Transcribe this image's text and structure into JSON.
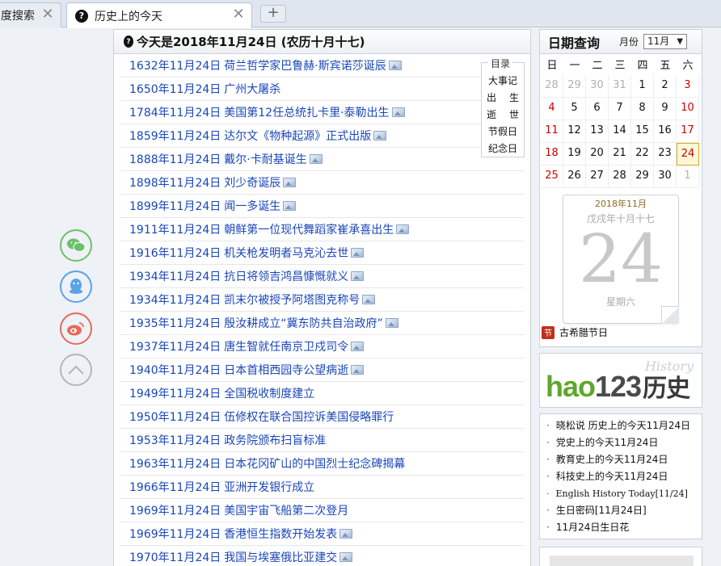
{
  "tabs": [
    {
      "label": "度搜索",
      "active": false
    },
    {
      "label": "历史上的今天",
      "active": true
    }
  ],
  "tab_close_glyph": "✕",
  "new_tab_glyph": "+",
  "main": {
    "title": "今天是2018年11月24日 (农历十月十七)",
    "events": [
      {
        "date": "1632年11月24日",
        "text": "荷兰哲学家巴鲁赫·斯宾诺莎诞辰",
        "has_image": true
      },
      {
        "date": "1650年11月24日",
        "text": "广州大屠杀",
        "has_image": false
      },
      {
        "date": "1784年11月24日",
        "text": "美国第12任总统扎卡里·泰勒出生",
        "has_image": true
      },
      {
        "date": "1859年11月24日",
        "text": "达尔文《物种起源》正式出版",
        "has_image": true
      },
      {
        "date": "1888年11月24日",
        "text": "戴尔·卡耐基诞生",
        "has_image": true
      },
      {
        "date": "1898年11月24日",
        "text": "刘少奇诞辰",
        "has_image": true
      },
      {
        "date": "1899年11月24日",
        "text": "闻一多诞生",
        "has_image": true
      },
      {
        "date": "1911年11月24日",
        "text": "朝鲜第一位现代舞蹈家崔承喜出生",
        "has_image": true
      },
      {
        "date": "1916年11月24日",
        "text": "机关枪发明者马克沁去世",
        "has_image": true
      },
      {
        "date": "1934年11月24日",
        "text": "抗日将领吉鸿昌慷慨就义",
        "has_image": true
      },
      {
        "date": "1934年11月24日",
        "text": "凯末尔被授予阿塔图克称号",
        "has_image": true
      },
      {
        "date": "1935年11月24日",
        "text": "殷汝耕成立“冀东防共自治政府”",
        "has_image": true
      },
      {
        "date": "1937年11月24日",
        "text": "唐生智就任南京卫戍司令",
        "has_image": true
      },
      {
        "date": "1940年11月24日",
        "text": "日本首相西园寺公望病逝",
        "has_image": true
      },
      {
        "date": "1949年11月24日",
        "text": "全国税收制度建立",
        "has_image": false
      },
      {
        "date": "1950年11月24日",
        "text": "伍修权在联合国控诉美国侵略罪行",
        "has_image": false
      },
      {
        "date": "1953年11月24日",
        "text": "政务院颁布扫盲标准",
        "has_image": false
      },
      {
        "date": "1963年11月24日",
        "text": "日本花冈矿山的中国烈士纪念碑揭幕",
        "has_image": false
      },
      {
        "date": "1966年11月24日",
        "text": "亚洲开发银行成立",
        "has_image": false
      },
      {
        "date": "1969年11月24日",
        "text": "美国宇宙飞船第二次登月",
        "has_image": false
      },
      {
        "date": "1969年11月24日",
        "text": "香港恒生指数开始发表",
        "has_image": true
      },
      {
        "date": "1970年11月24日",
        "text": "我国与埃塞俄比亚建交",
        "has_image": true
      }
    ]
  },
  "toc": {
    "title": "目录",
    "items": [
      {
        "label": "大事记"
      },
      {
        "left": "出",
        "right": "生"
      },
      {
        "left": "逝",
        "right": "世"
      },
      {
        "label": "节假日"
      },
      {
        "label": "纪念日"
      }
    ]
  },
  "calendar": {
    "title": "日期查询",
    "month_label": "月份",
    "selected_month": "11月",
    "weekdays": [
      "日",
      "一",
      "二",
      "三",
      "四",
      "五",
      "六"
    ],
    "days": [
      {
        "d": "28",
        "s": "gray"
      },
      {
        "d": "29",
        "s": "gray"
      },
      {
        "d": "30",
        "s": "gray"
      },
      {
        "d": "31",
        "s": "gray"
      },
      {
        "d": "1",
        "s": ""
      },
      {
        "d": "2",
        "s": ""
      },
      {
        "d": "3",
        "s": "red"
      },
      {
        "d": "4",
        "s": "red"
      },
      {
        "d": "5",
        "s": ""
      },
      {
        "d": "6",
        "s": ""
      },
      {
        "d": "7",
        "s": ""
      },
      {
        "d": "8",
        "s": ""
      },
      {
        "d": "9",
        "s": ""
      },
      {
        "d": "10",
        "s": "red"
      },
      {
        "d": "11",
        "s": "red"
      },
      {
        "d": "12",
        "s": ""
      },
      {
        "d": "13",
        "s": ""
      },
      {
        "d": "14",
        "s": ""
      },
      {
        "d": "15",
        "s": ""
      },
      {
        "d": "16",
        "s": ""
      },
      {
        "d": "17",
        "s": "red"
      },
      {
        "d": "18",
        "s": "red"
      },
      {
        "d": "19",
        "s": ""
      },
      {
        "d": "20",
        "s": ""
      },
      {
        "d": "21",
        "s": ""
      },
      {
        "d": "22",
        "s": ""
      },
      {
        "d": "23",
        "s": ""
      },
      {
        "d": "24",
        "s": "today"
      },
      {
        "d": "25",
        "s": "red"
      },
      {
        "d": "26",
        "s": ""
      },
      {
        "d": "27",
        "s": ""
      },
      {
        "d": "28",
        "s": ""
      },
      {
        "d": "29",
        "s": ""
      },
      {
        "d": "30",
        "s": ""
      },
      {
        "d": "1",
        "s": "gray"
      }
    ],
    "page": {
      "year_month": "2018年11月",
      "lunar": "戊戌年十月十七",
      "day": "24",
      "weekday": "星期六"
    },
    "holiday_icon_text": "节",
    "holiday": "古希腊节日"
  },
  "logo": {
    "history_en": "History",
    "green": "hao",
    "dark": "123",
    "cn": "历史"
  },
  "links": [
    {
      "text": "晓松说 历史上的今天11月24日",
      "mono": false
    },
    {
      "text": "党史上的今天11月24日",
      "mono": false
    },
    {
      "text": "教育史上的今天11月24日",
      "mono": false
    },
    {
      "text": "科技史上的今天11月24日",
      "mono": false
    },
    {
      "text": "English History Today[11/24]",
      "mono": true
    },
    {
      "text": "生日密码[11月24日]",
      "mono": false
    },
    {
      "text": "11月24日生日花",
      "mono": false
    }
  ],
  "colors": {
    "link_blue": "#1a46b8",
    "wechat": "#6cc06a",
    "qq": "#5aa3e8",
    "weibo": "#e86a5a",
    "top": "#b5b5b5"
  }
}
